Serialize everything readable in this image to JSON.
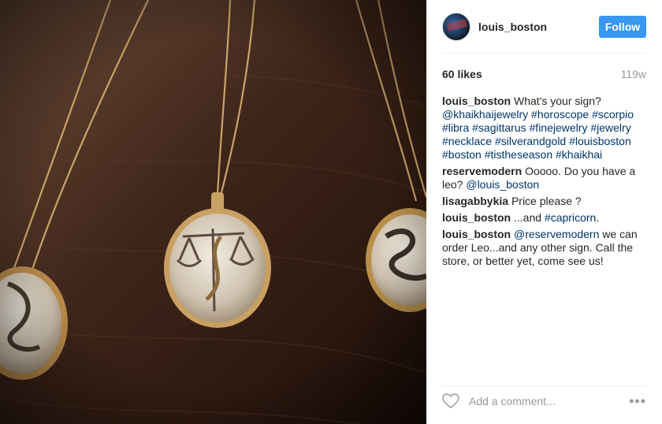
{
  "header": {
    "username": "louis_boston",
    "follow_label": "Follow"
  },
  "stats": {
    "likes": "60 likes",
    "age": "119w"
  },
  "comments": [
    {
      "user": "louis_boston",
      "parts": [
        {
          "t": "What's your sign? ",
          "tag": false
        },
        {
          "t": "@khaikhaijewelry",
          "tag": true
        },
        {
          "t": " ",
          "tag": false
        },
        {
          "t": "#horoscope",
          "tag": true
        },
        {
          "t": " ",
          "tag": false
        },
        {
          "t": "#scorpio",
          "tag": true
        },
        {
          "t": " ",
          "tag": false
        },
        {
          "t": "#libra",
          "tag": true
        },
        {
          "t": " ",
          "tag": false
        },
        {
          "t": "#sagittarus",
          "tag": true
        },
        {
          "t": " ",
          "tag": false
        },
        {
          "t": "#finejewelry",
          "tag": true
        },
        {
          "t": " ",
          "tag": false
        },
        {
          "t": "#jewelry",
          "tag": true
        },
        {
          "t": " ",
          "tag": false
        },
        {
          "t": "#necklace",
          "tag": true
        },
        {
          "t": " ",
          "tag": false
        },
        {
          "t": "#silverandgold",
          "tag": true
        },
        {
          "t": " ",
          "tag": false
        },
        {
          "t": "#louisboston",
          "tag": true
        },
        {
          "t": " ",
          "tag": false
        },
        {
          "t": "#boston",
          "tag": true
        },
        {
          "t": " ",
          "tag": false
        },
        {
          "t": "#tistheseason",
          "tag": true
        },
        {
          "t": " ",
          "tag": false
        },
        {
          "t": "#khaikhai",
          "tag": true
        }
      ]
    },
    {
      "user": "reservemodern",
      "parts": [
        {
          "t": "Ooooo. Do you have a leo? ",
          "tag": false
        },
        {
          "t": "@louis_boston",
          "tag": true
        }
      ]
    },
    {
      "user": "lisagabbykia",
      "parts": [
        {
          "t": "Price please ?",
          "tag": false
        }
      ]
    },
    {
      "user": "louis_boston",
      "parts": [
        {
          "t": "...and ",
          "tag": false
        },
        {
          "t": "#capricorn",
          "tag": true
        },
        {
          "t": ".",
          "tag": false
        }
      ]
    },
    {
      "user": "louis_boston",
      "parts": [
        {
          "t": "@reservemodern",
          "tag": true
        },
        {
          "t": " we can order Leo...and any other sign. Call the store, or better yet, come see us!",
          "tag": false
        }
      ]
    }
  ],
  "footer": {
    "placeholder": "Add a comment...",
    "more_label": "•••"
  },
  "colors": {
    "accent": "#3897f0",
    "hashtag": "#003569",
    "muted": "#999999"
  }
}
